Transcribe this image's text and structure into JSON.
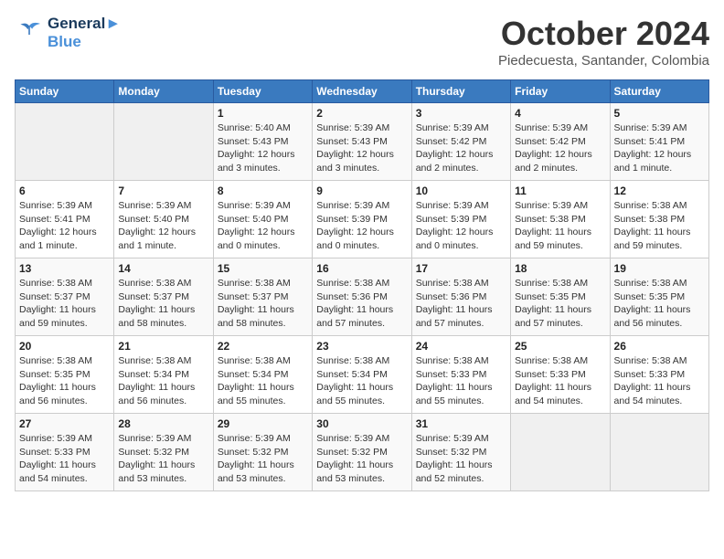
{
  "header": {
    "logo_line1": "General",
    "logo_line2": "Blue",
    "month_title": "October 2024",
    "location": "Piedecuesta, Santander, Colombia"
  },
  "days_of_week": [
    "Sunday",
    "Monday",
    "Tuesday",
    "Wednesday",
    "Thursday",
    "Friday",
    "Saturday"
  ],
  "weeks": [
    [
      {
        "day": "",
        "info": ""
      },
      {
        "day": "",
        "info": ""
      },
      {
        "day": "1",
        "sunrise": "5:40 AM",
        "sunset": "5:43 PM",
        "daylight": "12 hours and 3 minutes."
      },
      {
        "day": "2",
        "sunrise": "5:39 AM",
        "sunset": "5:43 PM",
        "daylight": "12 hours and 3 minutes."
      },
      {
        "day": "3",
        "sunrise": "5:39 AM",
        "sunset": "5:42 PM",
        "daylight": "12 hours and 2 minutes."
      },
      {
        "day": "4",
        "sunrise": "5:39 AM",
        "sunset": "5:42 PM",
        "daylight": "12 hours and 2 minutes."
      },
      {
        "day": "5",
        "sunrise": "5:39 AM",
        "sunset": "5:41 PM",
        "daylight": "12 hours and 1 minute."
      }
    ],
    [
      {
        "day": "6",
        "sunrise": "5:39 AM",
        "sunset": "5:41 PM",
        "daylight": "12 hours and 1 minute."
      },
      {
        "day": "7",
        "sunrise": "5:39 AM",
        "sunset": "5:40 PM",
        "daylight": "12 hours and 1 minute."
      },
      {
        "day": "8",
        "sunrise": "5:39 AM",
        "sunset": "5:40 PM",
        "daylight": "12 hours and 0 minutes."
      },
      {
        "day": "9",
        "sunrise": "5:39 AM",
        "sunset": "5:39 PM",
        "daylight": "12 hours and 0 minutes."
      },
      {
        "day": "10",
        "sunrise": "5:39 AM",
        "sunset": "5:39 PM",
        "daylight": "12 hours and 0 minutes."
      },
      {
        "day": "11",
        "sunrise": "5:39 AM",
        "sunset": "5:38 PM",
        "daylight": "11 hours and 59 minutes."
      },
      {
        "day": "12",
        "sunrise": "5:38 AM",
        "sunset": "5:38 PM",
        "daylight": "11 hours and 59 minutes."
      }
    ],
    [
      {
        "day": "13",
        "sunrise": "5:38 AM",
        "sunset": "5:37 PM",
        "daylight": "11 hours and 59 minutes."
      },
      {
        "day": "14",
        "sunrise": "5:38 AM",
        "sunset": "5:37 PM",
        "daylight": "11 hours and 58 minutes."
      },
      {
        "day": "15",
        "sunrise": "5:38 AM",
        "sunset": "5:37 PM",
        "daylight": "11 hours and 58 minutes."
      },
      {
        "day": "16",
        "sunrise": "5:38 AM",
        "sunset": "5:36 PM",
        "daylight": "11 hours and 57 minutes."
      },
      {
        "day": "17",
        "sunrise": "5:38 AM",
        "sunset": "5:36 PM",
        "daylight": "11 hours and 57 minutes."
      },
      {
        "day": "18",
        "sunrise": "5:38 AM",
        "sunset": "5:35 PM",
        "daylight": "11 hours and 57 minutes."
      },
      {
        "day": "19",
        "sunrise": "5:38 AM",
        "sunset": "5:35 PM",
        "daylight": "11 hours and 56 minutes."
      }
    ],
    [
      {
        "day": "20",
        "sunrise": "5:38 AM",
        "sunset": "5:35 PM",
        "daylight": "11 hours and 56 minutes."
      },
      {
        "day": "21",
        "sunrise": "5:38 AM",
        "sunset": "5:34 PM",
        "daylight": "11 hours and 56 minutes."
      },
      {
        "day": "22",
        "sunrise": "5:38 AM",
        "sunset": "5:34 PM",
        "daylight": "11 hours and 55 minutes."
      },
      {
        "day": "23",
        "sunrise": "5:38 AM",
        "sunset": "5:34 PM",
        "daylight": "11 hours and 55 minutes."
      },
      {
        "day": "24",
        "sunrise": "5:38 AM",
        "sunset": "5:33 PM",
        "daylight": "11 hours and 55 minutes."
      },
      {
        "day": "25",
        "sunrise": "5:38 AM",
        "sunset": "5:33 PM",
        "daylight": "11 hours and 54 minutes."
      },
      {
        "day": "26",
        "sunrise": "5:38 AM",
        "sunset": "5:33 PM",
        "daylight": "11 hours and 54 minutes."
      }
    ],
    [
      {
        "day": "27",
        "sunrise": "5:39 AM",
        "sunset": "5:33 PM",
        "daylight": "11 hours and 54 minutes."
      },
      {
        "day": "28",
        "sunrise": "5:39 AM",
        "sunset": "5:32 PM",
        "daylight": "11 hours and 53 minutes."
      },
      {
        "day": "29",
        "sunrise": "5:39 AM",
        "sunset": "5:32 PM",
        "daylight": "11 hours and 53 minutes."
      },
      {
        "day": "30",
        "sunrise": "5:39 AM",
        "sunset": "5:32 PM",
        "daylight": "11 hours and 53 minutes."
      },
      {
        "day": "31",
        "sunrise": "5:39 AM",
        "sunset": "5:32 PM",
        "daylight": "11 hours and 52 minutes."
      },
      {
        "day": "",
        "info": ""
      },
      {
        "day": "",
        "info": ""
      }
    ]
  ],
  "labels": {
    "sunrise": "Sunrise:",
    "sunset": "Sunset:",
    "daylight": "Daylight:"
  }
}
